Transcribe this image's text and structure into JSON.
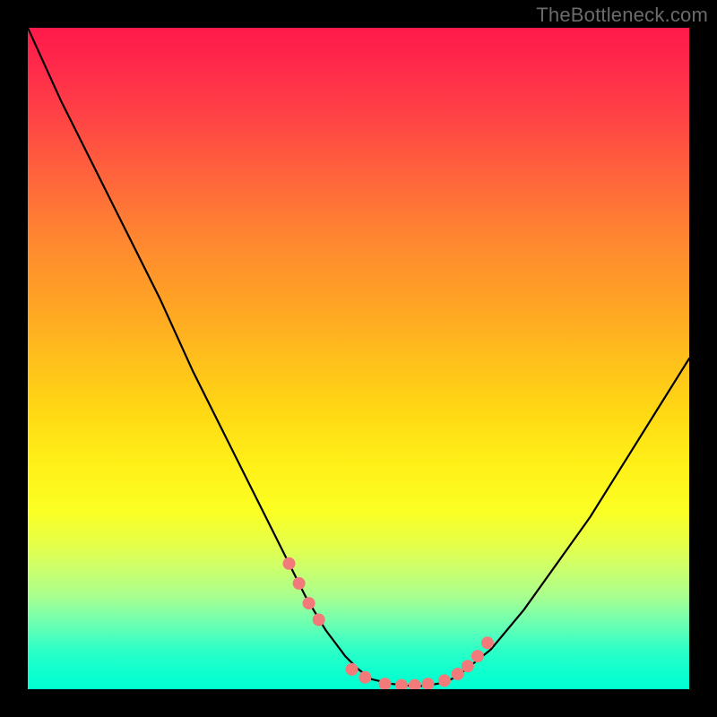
{
  "watermark": "TheBottleneck.com",
  "chart_data": {
    "type": "line",
    "title": "",
    "xlabel": "",
    "ylabel": "",
    "xlim": [
      0,
      100
    ],
    "ylim": [
      0,
      100
    ],
    "grid": false,
    "legend": "none",
    "series": [
      {
        "name": "bottleneck-curve",
        "color": "#000000",
        "x": [
          0,
          5,
          10,
          15,
          20,
          25,
          30,
          35,
          40,
          42,
          45,
          48,
          50,
          52,
          55,
          58,
          60,
          63,
          65,
          70,
          75,
          80,
          85,
          90,
          95,
          100
        ],
        "y": [
          100,
          89,
          79,
          69,
          59,
          48,
          38,
          28,
          18,
          14,
          9,
          5,
          3,
          1.5,
          0.8,
          0.5,
          0.5,
          1,
          2,
          6,
          12,
          19,
          26,
          34,
          42,
          50
        ]
      }
    ],
    "markers": {
      "name": "highlight-dots",
      "color": "#f27a7a",
      "radius": 7,
      "x": [
        39.5,
        41,
        42.5,
        44,
        49,
        51,
        54,
        56.5,
        58.5,
        60.5,
        63,
        65,
        66.5,
        68,
        69.5
      ],
      "y": [
        19,
        16,
        13,
        10.5,
        3,
        1.8,
        0.8,
        0.6,
        0.6,
        0.8,
        1.3,
        2.3,
        3.5,
        5,
        7
      ]
    },
    "gradient_stops": [
      {
        "pos": 0.0,
        "color": "#ff1a4a"
      },
      {
        "pos": 0.5,
        "color": "#ffd814"
      },
      {
        "pos": 0.78,
        "color": "#e6ff48"
      },
      {
        "pos": 1.0,
        "color": "#00ffd1"
      }
    ]
  }
}
